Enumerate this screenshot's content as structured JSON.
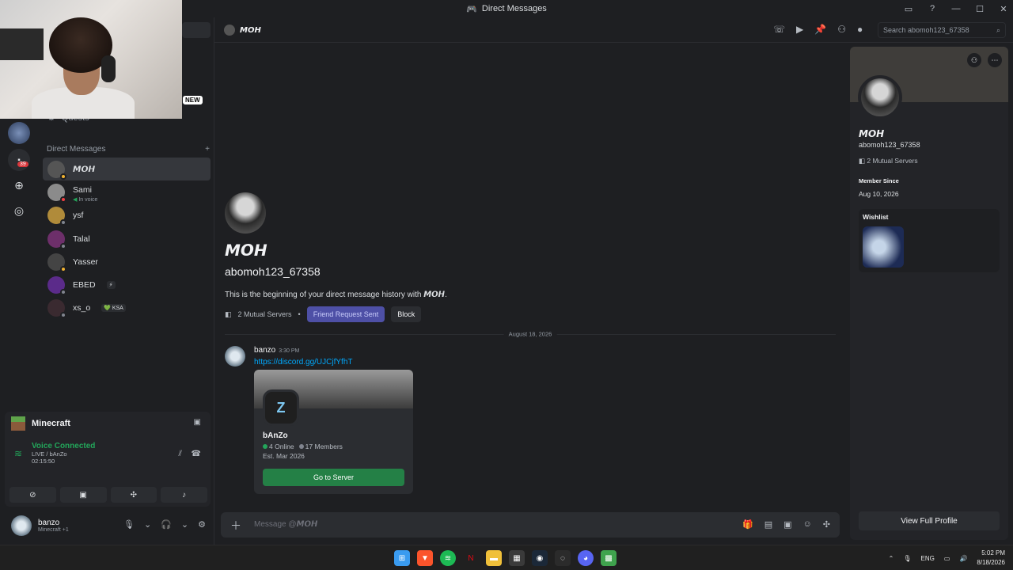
{
  "window": {
    "title": "Direct Messages",
    "controls": [
      "minimize",
      "maximize",
      "close"
    ]
  },
  "webcam": {
    "badge": "NEW"
  },
  "rail": {
    "mention_count": "39"
  },
  "sidebar": {
    "quests_label": "Quests",
    "dm_header": "Direct Messages",
    "add_dm": "+",
    "dms": [
      {
        "name": "𝙈𝙊𝙃",
        "sub": "",
        "color": "#555555",
        "status": "idle"
      },
      {
        "name": "Sami",
        "sub": "In voice",
        "color": "#8b8b8b",
        "status": "dnd"
      },
      {
        "name": "ysf",
        "sub": "",
        "color": "#b08b3a",
        "status": "offline"
      },
      {
        "name": "Talal",
        "sub": "",
        "color": "#6d2f6a",
        "status": "offline"
      },
      {
        "name": "Yasser",
        "sub": "",
        "color": "#444444",
        "status": "idle"
      },
      {
        "name": "EBED",
        "sub": "",
        "badge": "⚡",
        "color": "#5b2b8a",
        "status": "offline"
      },
      {
        "name": "xs_o",
        "sub": "",
        "badge": "💚 KSA",
        "color": "#3a2a30",
        "status": "offline"
      }
    ]
  },
  "activity": {
    "game": "Minecraft",
    "voice_status": "Voice Connected",
    "channel": "LIVE / bAnZo",
    "timer": "02:15:50"
  },
  "user": {
    "name": "banzo",
    "sub": "Minecraft +1"
  },
  "header": {
    "dm_name": "𝙈𝙊𝙃",
    "search_placeholder": "Search abomoh123_67358"
  },
  "intro": {
    "display_name": "𝙈𝙊𝙃",
    "username": "abomoh123_67358",
    "text_prefix": "This is the beginning of your direct message history with ",
    "text_name": "𝙈𝙊𝙃",
    "text_suffix": ".",
    "mutual_servers": "2 Mutual Servers",
    "friend_request": "Friend Request Sent",
    "block": "Block"
  },
  "messages": {
    "date": "August 18, 2026",
    "author": "banzo",
    "time": "3:30 PM",
    "link": "https://discord.gg/UJCjfYfhT",
    "invite": {
      "server_name": "bAnZo",
      "online": "4 Online",
      "members": "17 Members",
      "established": "Est. Mar 2026",
      "button": "Go to Server"
    }
  },
  "composer": {
    "placeholder_prefix": "Message @",
    "placeholder_name": "𝙈𝙊𝙃"
  },
  "profile": {
    "display_name": "𝙈𝙊𝙃",
    "username": "abomoh123_67358",
    "mutual_servers": "2 Mutual Servers",
    "member_since_label": "Member Since",
    "member_since": "Aug 10, 2026",
    "wishlist_label": "Wishlist",
    "view_full": "View Full Profile"
  },
  "taskbar": {
    "lang": "ENG",
    "time": "5:02 PM",
    "date": "8/18/2026"
  },
  "colors": {
    "accent": "#5865f2",
    "online": "#23a55a",
    "link": "#00a8fc",
    "go_button": "#248046"
  }
}
